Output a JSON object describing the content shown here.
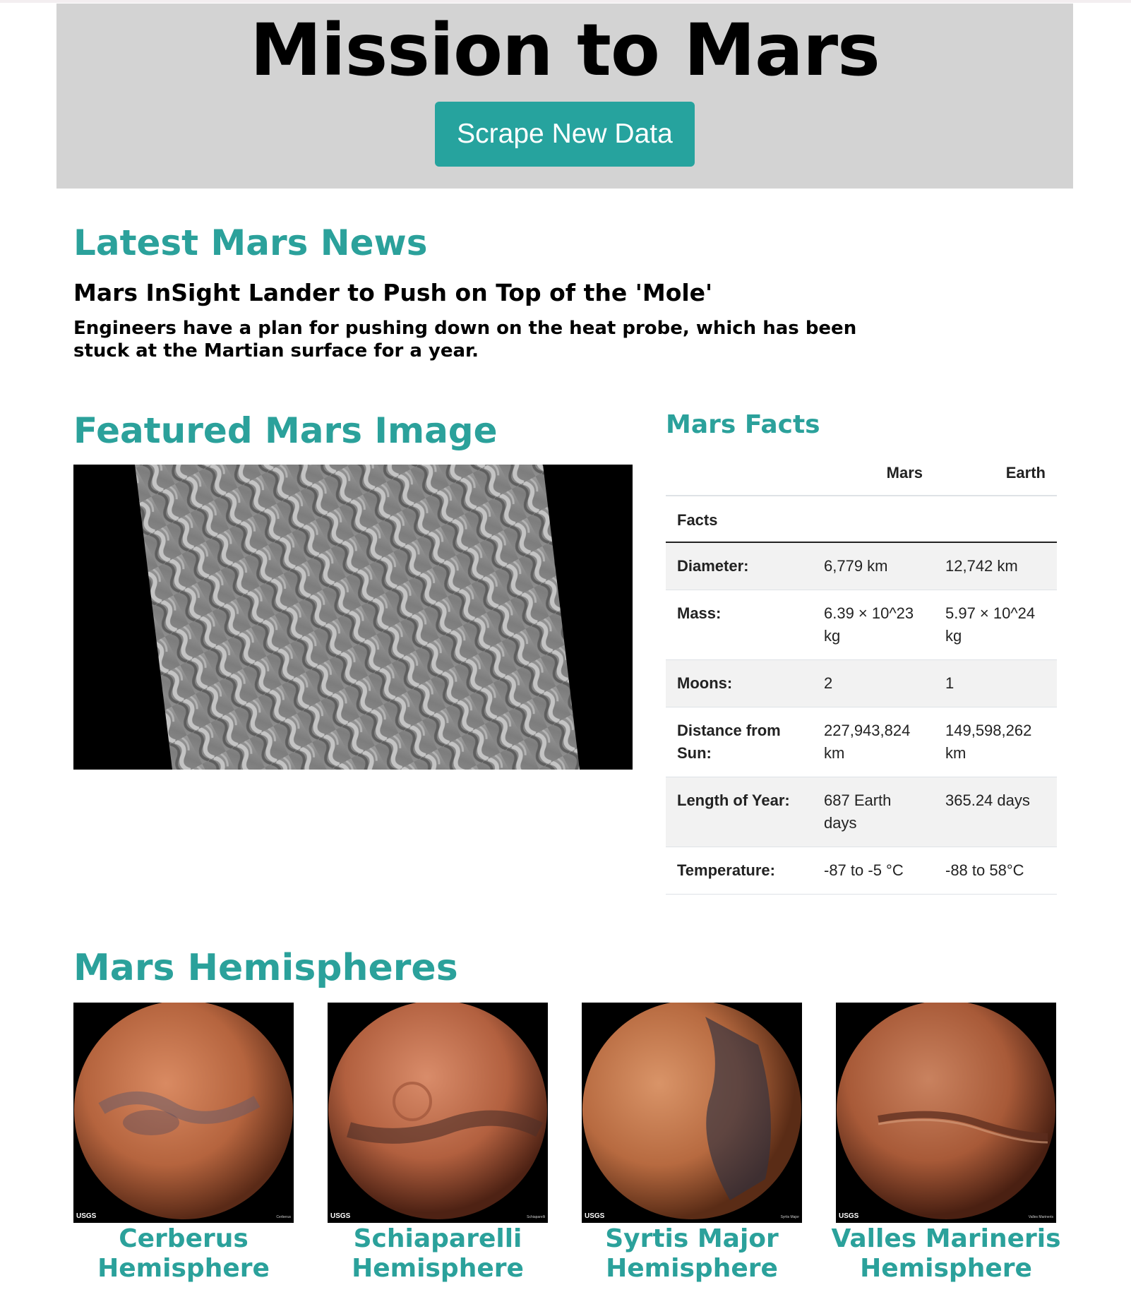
{
  "header": {
    "title": "Mission to Mars",
    "scrape_button": "Scrape New Data"
  },
  "news": {
    "section_title": "Latest Mars News",
    "title": "Mars InSight Lander to Push on Top of the 'Mole'",
    "teaser": "Engineers have a plan for pushing down on the heat probe, which has been stuck at the Martian surface for a year."
  },
  "featured": {
    "section_title": "Featured Mars Image"
  },
  "facts": {
    "section_title": "Mars Facts",
    "columns": [
      "Mars",
      "Earth"
    ],
    "index_label": "Facts",
    "rows": [
      {
        "label": "Diameter:",
        "mars": "6,779 km",
        "earth": "12,742 km"
      },
      {
        "label": "Mass:",
        "mars": "6.39 × 10^23 kg",
        "earth": "5.97 × 10^24 kg"
      },
      {
        "label": "Moons:",
        "mars": "2",
        "earth": "1"
      },
      {
        "label": "Distance from Sun:",
        "mars": "227,943,824 km",
        "earth": "149,598,262 km"
      },
      {
        "label": "Length of Year:",
        "mars": "687 Earth days",
        "earth": "365.24 days"
      },
      {
        "label": "Temperature:",
        "mars": "-87 to -5 °C",
        "earth": "-88 to 58°C"
      }
    ]
  },
  "hemispheres": {
    "section_title": "Mars Hemispheres",
    "items": [
      {
        "title": "Cerberus Hemisphere",
        "caption": "Cerberus",
        "logo": "USGS"
      },
      {
        "title": "Schiaparelli Hemisphere",
        "caption": "Schiaparelli",
        "logo": "USGS"
      },
      {
        "title": "Syrtis Major Hemisphere",
        "caption": "Syrtis Major",
        "logo": "USGS"
      },
      {
        "title": "Valles Marineris Hemisphere",
        "caption": "Valles Marineris",
        "logo": "USGS"
      }
    ]
  },
  "colors": {
    "accent": "#2ba19b",
    "button": "#26a39e",
    "jumbotron": "#d3d3d3"
  }
}
